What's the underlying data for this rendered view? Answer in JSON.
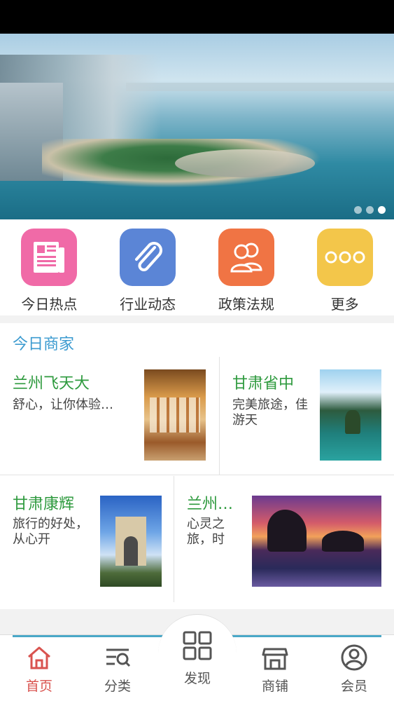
{
  "banner": {
    "slide_count": 3,
    "active_slide": 3
  },
  "quick_menu": [
    {
      "label": "今日热点",
      "icon": "newspaper-icon",
      "color": "#f06aa7"
    },
    {
      "label": "行业动态",
      "icon": "paperclip-icon",
      "color": "#5b85d6"
    },
    {
      "label": "政策法规",
      "icon": "people-icon",
      "color": "#f07444"
    },
    {
      "label": "更多",
      "icon": "more-dots-icon",
      "color": "#f3c64a"
    }
  ],
  "merchants": {
    "title": "今日商家",
    "items": [
      {
        "name": "兰州飞天大",
        "desc": "舒心，让你体验…",
        "image": "restaurant-photo"
      },
      {
        "name": "甘肃省中",
        "desc": "完美旅途，佳游天",
        "image": "lake-mountain-photo"
      },
      {
        "name": "甘肃康辉",
        "desc": "旅行的好处，从心开",
        "image": "arch-monument-photo"
      },
      {
        "name": "兰州…",
        "desc": "心灵之旅，时",
        "image": "sunset-sea-photo"
      }
    ]
  },
  "bottom_nav": [
    {
      "label": "首页",
      "icon": "home-icon",
      "active": true
    },
    {
      "label": "分类",
      "icon": "category-search-icon",
      "active": false
    },
    {
      "label": "发现",
      "icon": "grid-icon",
      "active": false
    },
    {
      "label": "商铺",
      "icon": "shop-icon",
      "active": false
    },
    {
      "label": "会员",
      "icon": "user-icon",
      "active": false
    }
  ],
  "colors": {
    "accent_blue": "#3c9bd0",
    "merchant_green": "#2e9a3e",
    "nav_active": "#d9534f"
  }
}
